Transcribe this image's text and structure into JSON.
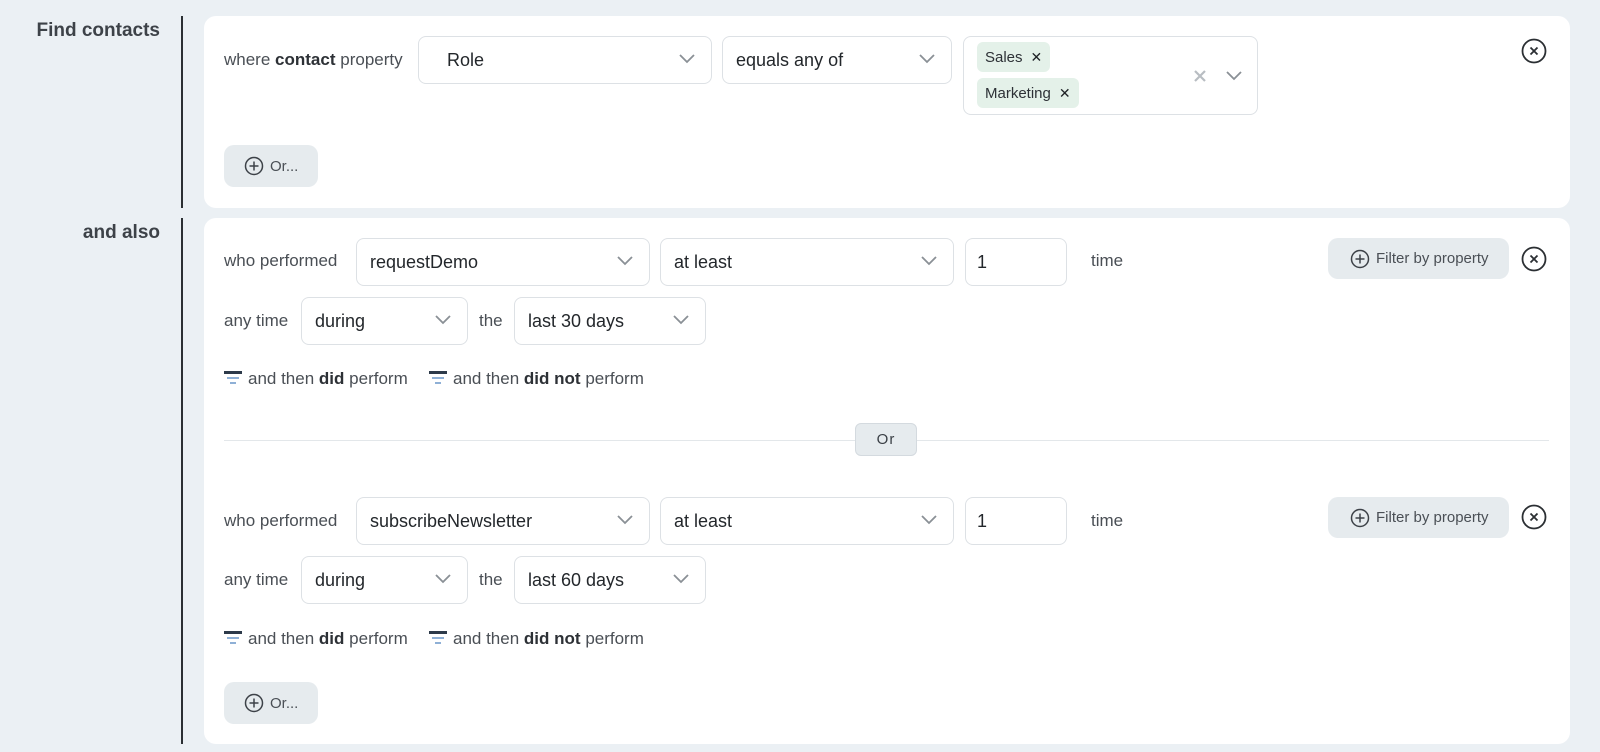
{
  "labels": {
    "find_contacts": "Find contacts",
    "and_also": "and also"
  },
  "contact_filter": {
    "where": "where",
    "contact": "contact",
    "property": "property",
    "property_value": "Role",
    "operator_value": "equals any of",
    "tags": [
      "Sales",
      "Marketing"
    ],
    "or_button": "Or..."
  },
  "event_filters": [
    {
      "who_performed": "who performed",
      "event": "requestDemo",
      "comparator": "at least",
      "count": "1",
      "time_word": "time",
      "filter_by_property": "Filter by property",
      "any_time": "any time",
      "during": "during",
      "the": "the",
      "range": "last 30 days",
      "then_did_prefix": "and then",
      "then_did_bold": "did",
      "then_did_suffix": "perform",
      "then_not_prefix": "and then",
      "then_not_bold": "did not",
      "then_not_suffix": "perform"
    },
    {
      "who_performed": "who performed",
      "event": "subscribeNewsletter",
      "comparator": "at least",
      "count": "1",
      "time_word": "time",
      "filter_by_property": "Filter by property",
      "any_time": "any time",
      "during": "during",
      "the": "the",
      "range": "last 60 days",
      "then_did_prefix": "and then",
      "then_did_bold": "did",
      "then_did_suffix": "perform",
      "then_not_prefix": "and then",
      "then_not_bold": "did not",
      "then_not_suffix": "perform"
    }
  ],
  "or_divider": "Or",
  "or_button_bottom": "Or...",
  "colors": {
    "background": "#ebf0f4",
    "card": "#ffffff",
    "tag_bg": "#e4f1e9",
    "button_bg": "#e6ebee"
  }
}
